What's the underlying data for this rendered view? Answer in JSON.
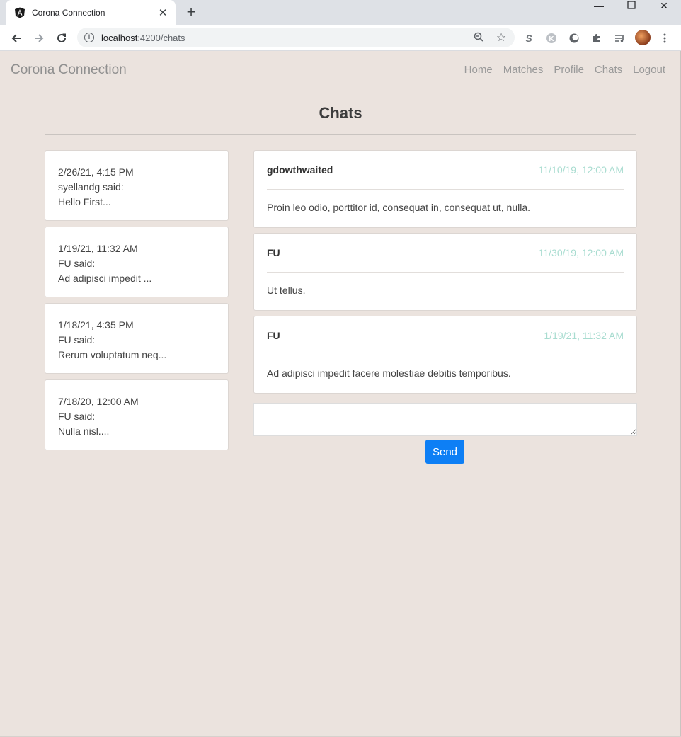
{
  "browser": {
    "tab_title": "Corona Connection",
    "url_host": "localhost",
    "url_rest": ":4200/chats",
    "icons": [
      "angular-icon",
      "close-icon",
      "plus-icon",
      "back-icon",
      "forward-icon",
      "reload-icon",
      "info-icon",
      "zoom-icon",
      "star-icon",
      "extension-s-icon",
      "extension-k-icon",
      "extension-circle-icon",
      "puzzle-icon",
      "media-icon",
      "avatar",
      "menu-icon"
    ]
  },
  "navbar": {
    "brand": "Corona Connection",
    "links": [
      "Home",
      "Matches",
      "Profile",
      "Chats",
      "Logout"
    ]
  },
  "page": {
    "title": "Chats"
  },
  "chat_list": [
    {
      "time": "2/26/21, 4:15 PM",
      "who": "syellandg said:",
      "preview": "Hello First..."
    },
    {
      "time": "1/19/21, 11:32 AM",
      "who": "FU said:",
      "preview": "Ad adipisci impedit ..."
    },
    {
      "time": "1/18/21, 4:35 PM",
      "who": "FU said:",
      "preview": "Rerum voluptatum neq..."
    },
    {
      "time": "7/18/20, 12:00 AM",
      "who": "FU said:",
      "preview": "Nulla nisl...."
    }
  ],
  "messages": [
    {
      "author": "gdowthwaited",
      "time": "11/10/19, 12:00 AM",
      "body": "Proin leo odio, porttitor id, consequat in, consequat ut, nulla."
    },
    {
      "author": "FU",
      "time": "11/30/19, 12:00 AM",
      "body": "Ut tellus."
    },
    {
      "author": "FU",
      "time": "1/19/21, 11:32 AM",
      "body": "Ad adipisci impedit facere molestiae debitis temporibus."
    }
  ],
  "reply": {
    "value": "",
    "send_label": "Send"
  },
  "colors": {
    "page_bg": "#ebe3de",
    "timestamp": "#a8dcd0",
    "send_button": "#0d7ff5"
  }
}
